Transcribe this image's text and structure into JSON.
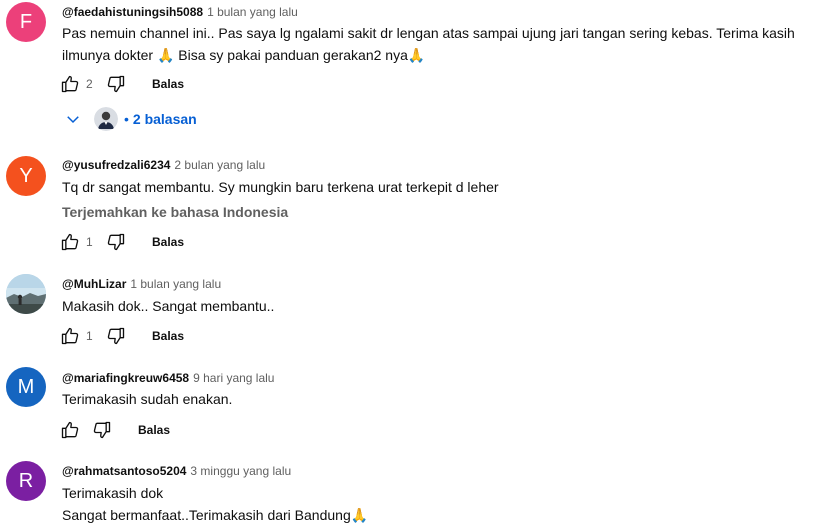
{
  "colors": {
    "avatar_f": "#ec407a",
    "avatar_y": "#f4511e",
    "avatar_m": "#1565c0",
    "avatar_r": "#7b1fa2",
    "link_blue": "#065fd4",
    "meta_gray": "#606060"
  },
  "comments": [
    {
      "avatar_letter": "F",
      "author": "@faedahistuningsih5088",
      "time": "1 bulan yang lalu",
      "line1": "Pas nemuin channel ini.. Pas saya lg ngalami sakit dr lengan atas sampai ujung jari tangan sering kebas. Terima kasih",
      "line2": "ilmunya dokter",
      "line2_after": " Bisa sy pakai panduan gerakan2 nya",
      "likes": "2",
      "reply_label": "Balas",
      "replies_label": "2 balasan",
      "replies_dot": "•"
    },
    {
      "avatar_letter": "Y",
      "author": "@yusufredzali6234",
      "time": "2 bulan yang lalu",
      "line1": "Tq dr  sangat membantu. Sy mungkin baru terkena urat terkepit d leher",
      "translate": "Terjemahkan ke bahasa Indonesia",
      "likes": "1",
      "reply_label": "Balas"
    },
    {
      "author": "@MuhLizar",
      "time": "1 bulan yang lalu",
      "line1": "Makasih dok.. Sangat membantu..",
      "likes": "1",
      "reply_label": "Balas"
    },
    {
      "avatar_letter": "M",
      "author": "@mariafingkreuw6458",
      "time": "9 hari yang lalu",
      "line1": "Terimakasih sudah enakan.",
      "likes": "",
      "reply_label": "Balas"
    },
    {
      "avatar_letter": "R",
      "author": "@rahmatsantoso5204",
      "time": "3 minggu yang lalu",
      "line1": "Terimakasih dok",
      "line2": "Sangat bermanfaat..Terimakasih dari Bandung",
      "likes": "",
      "reply_label": "Balas"
    }
  ],
  "emoji": "🙏"
}
